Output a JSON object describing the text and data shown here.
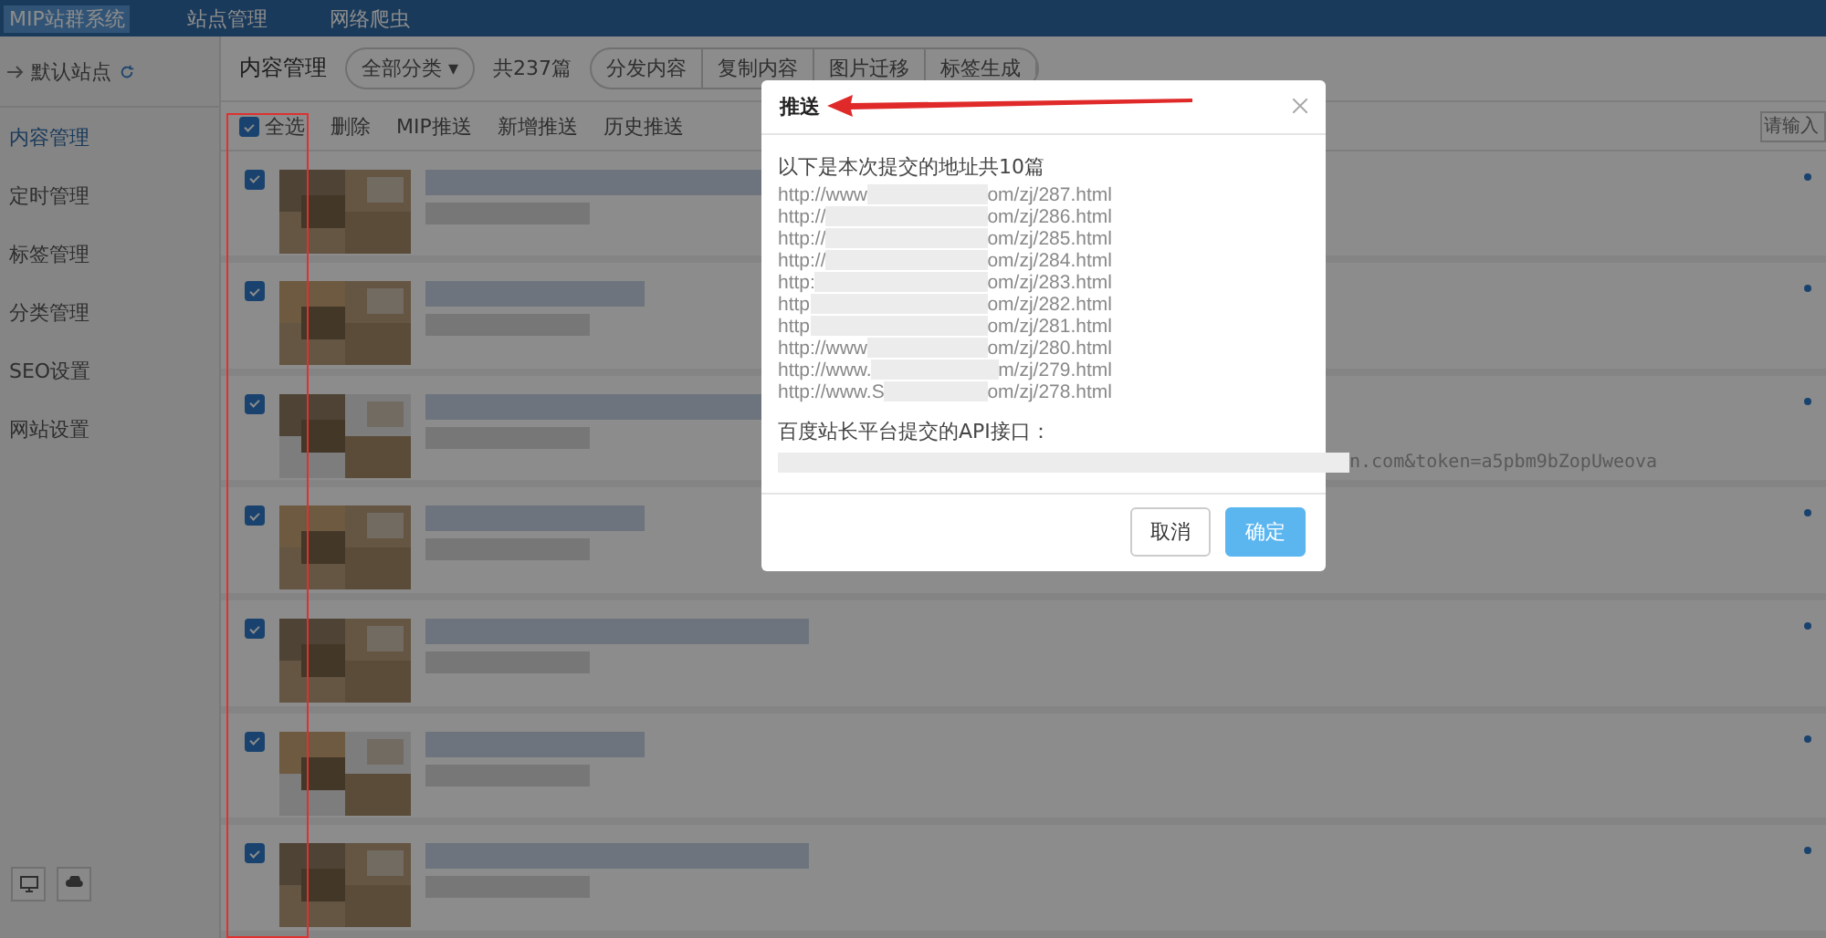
{
  "top_nav": [
    {
      "label": "MIP站群系统",
      "selected": true
    },
    {
      "label": "站点管理",
      "selected": false
    },
    {
      "label": "网络爬虫",
      "selected": false
    }
  ],
  "sidebar": {
    "site": "默认站点",
    "items": [
      {
        "label": "内容管理",
        "selected": true
      },
      {
        "label": "定时管理",
        "selected": false
      },
      {
        "label": "标签管理",
        "selected": false
      },
      {
        "label": "分类管理",
        "selected": false
      },
      {
        "label": "SEO设置",
        "selected": false
      },
      {
        "label": "网站设置",
        "selected": false
      }
    ]
  },
  "header": {
    "title": "内容管理",
    "category": "全部分类 ▾",
    "count": "共237篇",
    "actions": [
      "分发内容",
      "复制内容",
      "图片迁移",
      "标签生成"
    ]
  },
  "toolbar": {
    "select_all": {
      "label": "全选",
      "checked": true
    },
    "actions": [
      "删除",
      "MIP推送",
      "新增推送",
      "历史推送"
    ],
    "search": {
      "placeholder": "请输入"
    }
  },
  "rows": [
    {
      "checked": true
    },
    {
      "checked": true
    },
    {
      "checked": true
    },
    {
      "checked": true
    },
    {
      "checked": true
    },
    {
      "checked": true
    },
    {
      "checked": true
    }
  ],
  "dialog": {
    "title": "推送",
    "intro": "以下是本次提交的地址共10篇",
    "urls": [
      {
        "prefix": "http://www",
        "suffix": "om/zj/287.html"
      },
      {
        "prefix": "http://",
        "suffix": "om/zj/286.html"
      },
      {
        "prefix": "http://",
        "suffix": "om/zj/285.html"
      },
      {
        "prefix": "http://",
        "suffix": "om/zj/284.html"
      },
      {
        "prefix": "http:",
        "suffix": "om/zj/283.html"
      },
      {
        "prefix": "http",
        "suffix": "om/zj/282.html"
      },
      {
        "prefix": "http",
        "suffix": "om/zj/281.html"
      },
      {
        "prefix": "http://www",
        "suffix": "om/zj/280.html"
      },
      {
        "prefix": "http://www.",
        "suffix": "m/zj/279.html"
      },
      {
        "prefix": "http://www.S",
        "suffix": "om/zj/278.html"
      }
    ],
    "api_label": "百度站长平台提交的API接口：",
    "api_tail": "n.com&token=a5pbm9bZopUweova",
    "buttons": [
      {
        "label": "取消",
        "kind": "secondary"
      },
      {
        "label": "确定",
        "kind": "primary"
      }
    ]
  }
}
